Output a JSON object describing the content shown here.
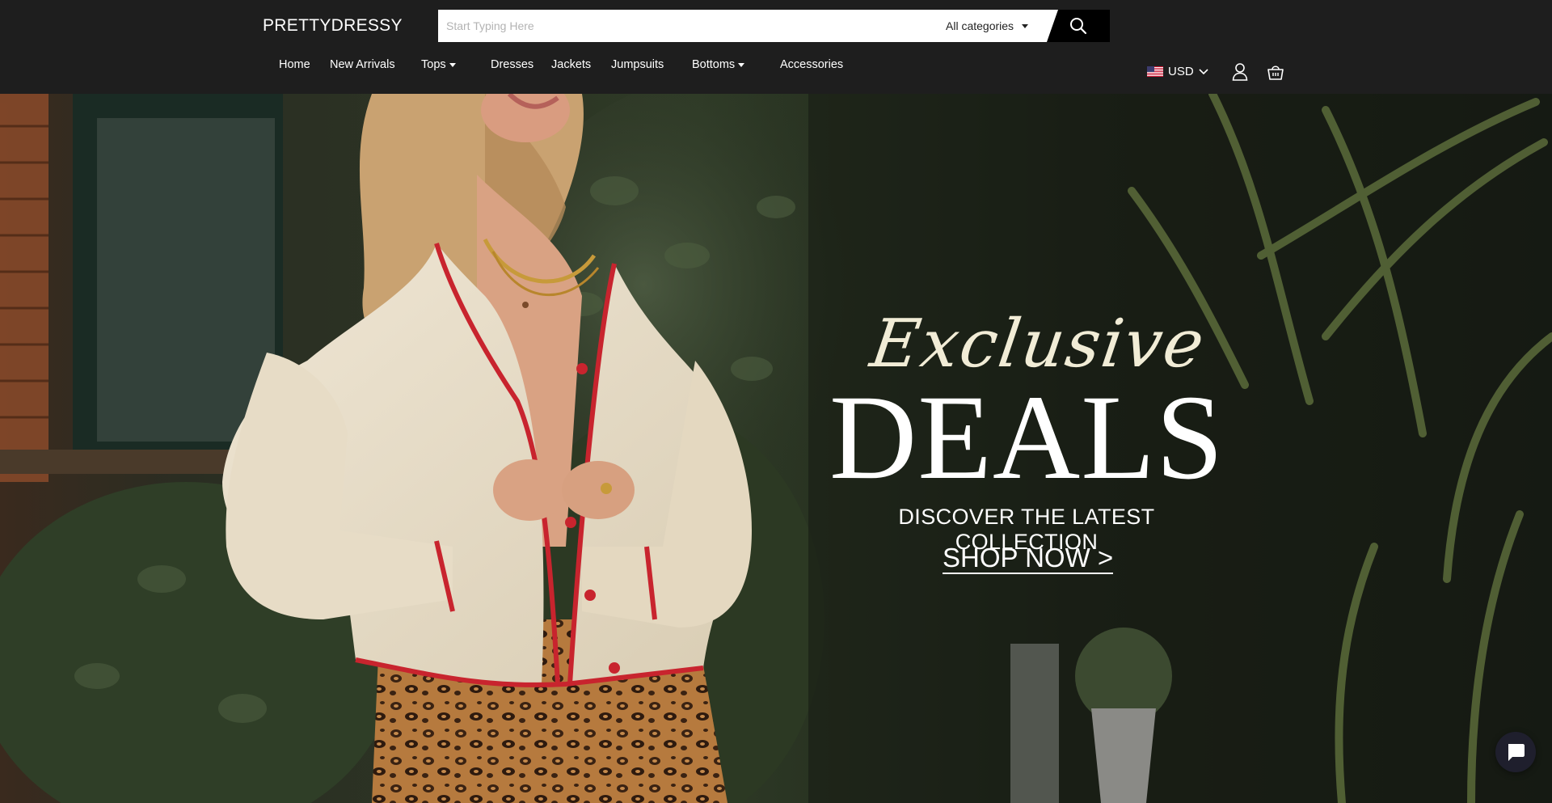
{
  "header": {
    "logo": "PRETTYDRESSY",
    "search": {
      "placeholder": "Start Typing Here",
      "category": "All categories"
    },
    "nav": [
      {
        "label": "Home"
      },
      {
        "label": "New Arrivals"
      },
      {
        "label": "Tops"
      },
      {
        "label": "Dresses"
      },
      {
        "label": "Jackets"
      },
      {
        "label": "Jumpsuits"
      },
      {
        "label": "Bottoms"
      },
      {
        "label": "Accessories"
      }
    ],
    "currency": "USD"
  },
  "hero": {
    "script_title": "Exclusive",
    "title": "DEALS",
    "subtitle": "DISCOVER THE LATEST COLLECTION",
    "cta": "SHOP NOW >"
  },
  "colors": {
    "header_bg": "#1e1e1e",
    "search_button_bg": "#000000",
    "chat_bubble_bg": "#1f1f2d"
  },
  "icons": {
    "search": "search-icon",
    "account": "user-icon",
    "cart": "shopping-bag-icon",
    "chat": "chat-icon",
    "flag": "us-flag-icon"
  }
}
